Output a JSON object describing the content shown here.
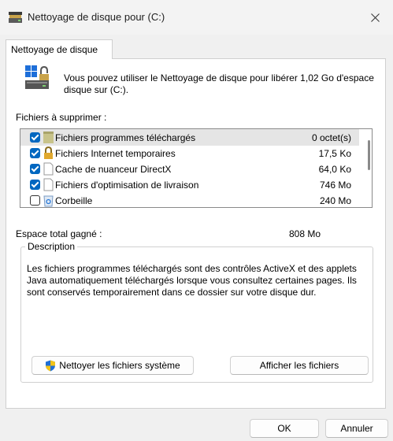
{
  "window": {
    "title": "Nettoyage de disque pour  (C:)"
  },
  "tab": {
    "label": "Nettoyage de disque"
  },
  "intro": {
    "text": "Vous pouvez utiliser le Nettoyage de disque pour libérer 1,02 Go d'espace disque sur  (C:)."
  },
  "files": {
    "label": "Fichiers à supprimer :",
    "items": [
      {
        "name": "Fichiers programmes téléchargés",
        "size": "0 octet(s)",
        "checked": true,
        "selected": true,
        "icon": "folder-icon"
      },
      {
        "name": "Fichiers Internet temporaires",
        "size": "17,5 Ko",
        "checked": true,
        "selected": false,
        "icon": "lock-icon"
      },
      {
        "name": "Cache de nuanceur DirectX",
        "size": "64,0 Ko",
        "checked": true,
        "selected": false,
        "icon": "file-icon"
      },
      {
        "name": "Fichiers d'optimisation de livraison",
        "size": "746 Mo",
        "checked": true,
        "selected": false,
        "icon": "file-icon"
      },
      {
        "name": "Corbeille",
        "size": "240 Mo",
        "checked": false,
        "selected": false,
        "icon": "recycle-bin-icon"
      }
    ]
  },
  "space": {
    "label": "Espace total gagné :",
    "value": "808 Mo"
  },
  "description": {
    "legend": "Description",
    "text": "Les fichiers programmes téléchargés sont des contrôles ActiveX et des applets Java automatiquement téléchargés lorsque vous consultez certaines pages. Ils sont conservés temporairement dans ce dossier sur votre disque dur."
  },
  "buttons": {
    "clean_system": "Nettoyer les fichiers système",
    "view_files": "Afficher les fichiers",
    "ok": "OK",
    "cancel": "Annuler"
  },
  "colors": {
    "accent": "#0067c0"
  }
}
